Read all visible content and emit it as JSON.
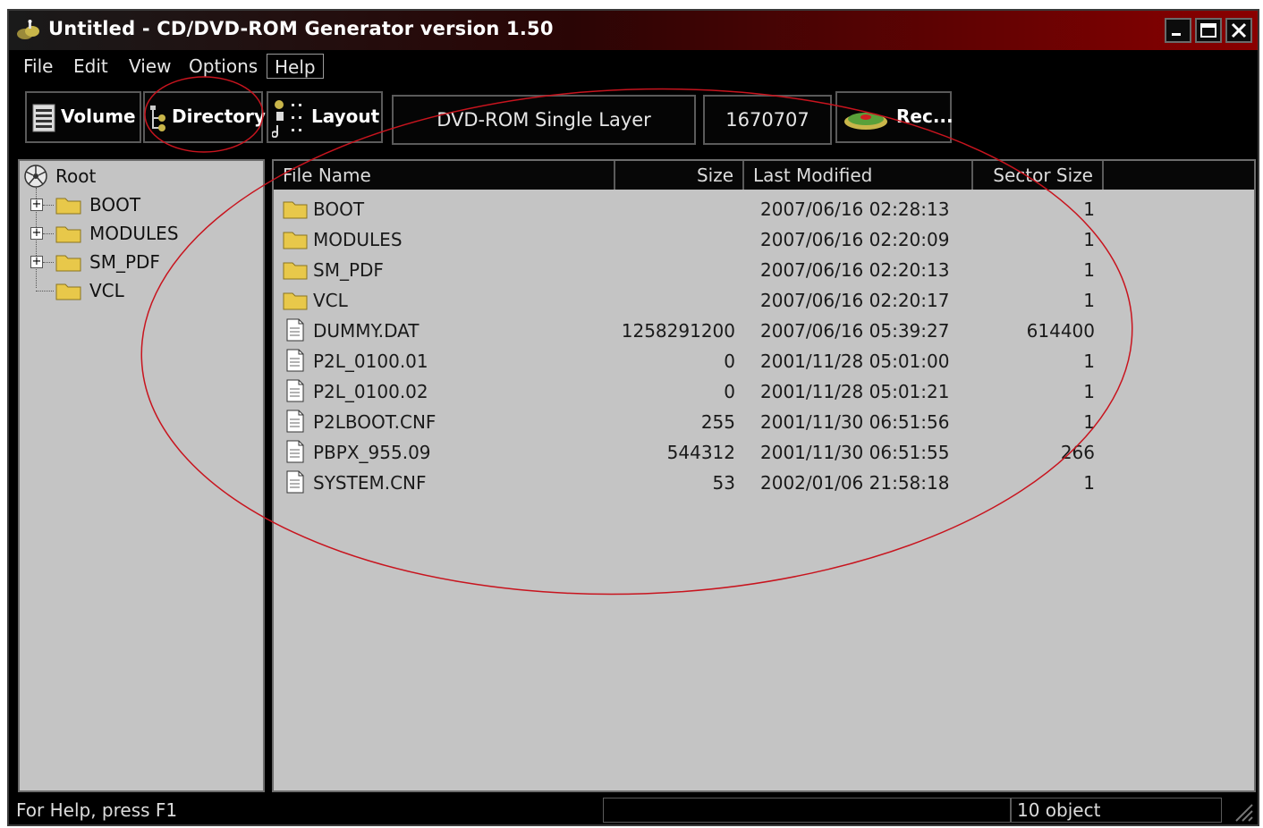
{
  "window": {
    "title": "Untitled - CD/DVD-ROM Generator version 1.50",
    "controls": [
      "minimize",
      "maximize",
      "close"
    ]
  },
  "menu": [
    "File",
    "Edit",
    "View",
    "Options",
    "Help"
  ],
  "toolbar": {
    "volume": "Volume",
    "directory": "Directory",
    "layout": "Layout",
    "media_type": "DVD-ROM Single Layer",
    "sector_count": "1670707",
    "record": "Rec..."
  },
  "tree": {
    "root": "Root",
    "children": [
      {
        "label": "BOOT",
        "expandable": true
      },
      {
        "label": "MODULES",
        "expandable": true
      },
      {
        "label": "SM_PDF",
        "expandable": true
      },
      {
        "label": "VCL",
        "expandable": false
      }
    ]
  },
  "list": {
    "columns": [
      "File Name",
      "Size",
      "Last Modified",
      "Sector Size"
    ],
    "rows": [
      {
        "type": "folder",
        "name": "BOOT",
        "size": "",
        "modified": "2007/06/16 02:28:13",
        "sector": "1"
      },
      {
        "type": "folder",
        "name": "MODULES",
        "size": "",
        "modified": "2007/06/16 02:20:09",
        "sector": "1"
      },
      {
        "type": "folder",
        "name": "SM_PDF",
        "size": "",
        "modified": "2007/06/16 02:20:13",
        "sector": "1"
      },
      {
        "type": "folder",
        "name": "VCL",
        "size": "",
        "modified": "2007/06/16 02:20:17",
        "sector": "1"
      },
      {
        "type": "file",
        "name": "DUMMY.DAT",
        "size": "1258291200",
        "modified": "2007/06/16 05:39:27",
        "sector": "614400"
      },
      {
        "type": "file",
        "name": "P2L_0100.01",
        "size": "0",
        "modified": "2001/11/28 05:01:00",
        "sector": "1"
      },
      {
        "type": "file",
        "name": "P2L_0100.02",
        "size": "0",
        "modified": "2001/11/28 05:01:21",
        "sector": "1"
      },
      {
        "type": "file",
        "name": "P2LBOOT.CNF",
        "size": "255",
        "modified": "2001/11/30 06:51:56",
        "sector": "1"
      },
      {
        "type": "file",
        "name": "PBPX_955.09",
        "size": "544312",
        "modified": "2001/11/30 06:51:55",
        "sector": "266"
      },
      {
        "type": "file",
        "name": "SYSTEM.CNF",
        "size": "53",
        "modified": "2002/01/06 21:58:18",
        "sector": "1"
      }
    ]
  },
  "status": {
    "help": "For Help, press F1",
    "count": "10 object"
  },
  "colors": {
    "pane_bg": "#c4c4c4",
    "chrome_bg": "#000000",
    "title_accent": "#8a0000",
    "annotation": "#c8141e",
    "folder": "#e8c84a"
  }
}
